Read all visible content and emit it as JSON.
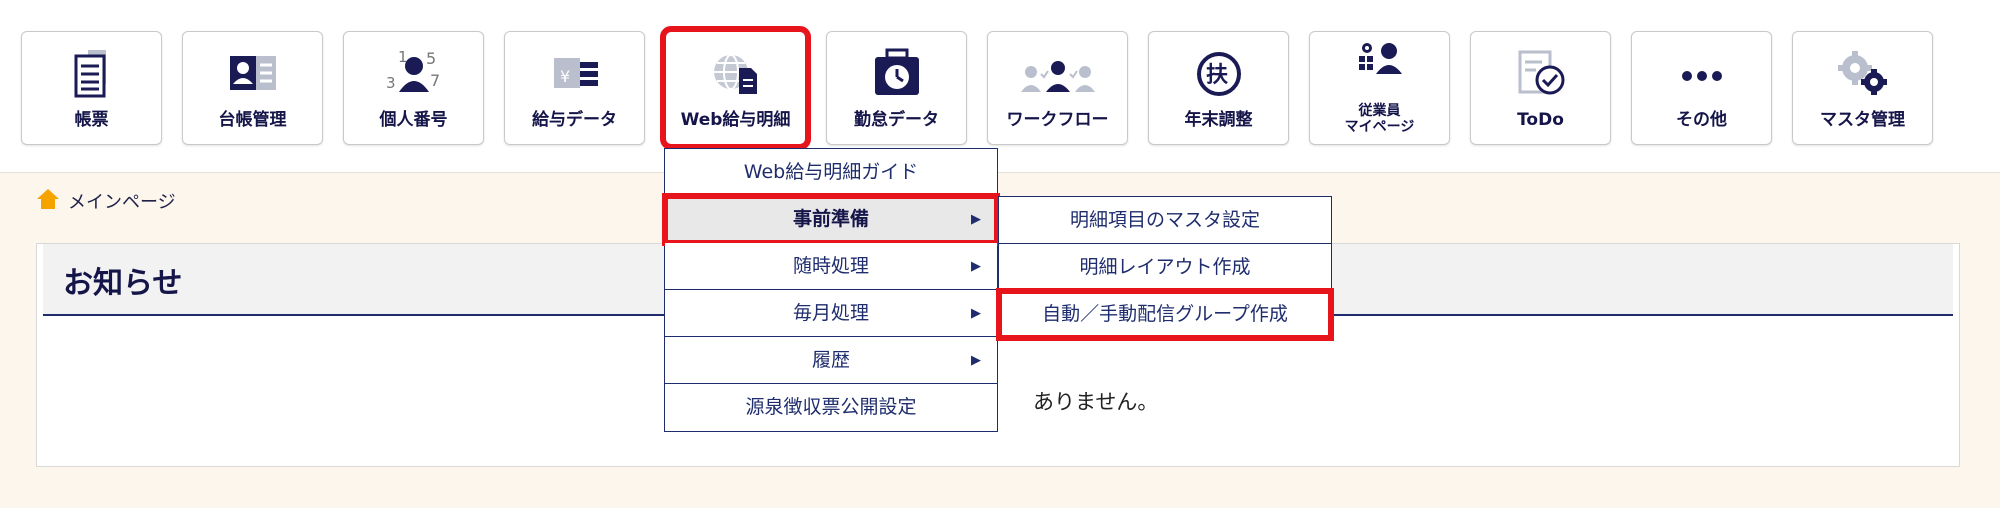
{
  "nav": {
    "items": [
      {
        "label": "帳票",
        "icon": "document-stack-icon"
      },
      {
        "label": "台帳管理",
        "icon": "id-card-icon"
      },
      {
        "label": "個人番号",
        "icon": "person-number-icon"
      },
      {
        "label": "給与データ",
        "icon": "payroll-data-icon"
      },
      {
        "label": "Web給与明細",
        "icon": "globe-document-icon"
      },
      {
        "label": "勤怠データ",
        "icon": "clock-box-icon"
      },
      {
        "label": "ワークフロー",
        "icon": "workflow-people-icon"
      },
      {
        "label": "年末調整",
        "icon": "fu-circle-icon"
      },
      {
        "label": "従業員",
        "label2": "マイページ",
        "icon": "employee-grid-icon"
      },
      {
        "label": "ToDo",
        "icon": "todo-check-icon"
      },
      {
        "label": "その他",
        "icon": "more-dots-icon"
      },
      {
        "label": "マスタ管理",
        "icon": "gears-icon"
      }
    ]
  },
  "breadcrumb": {
    "label": "メインページ",
    "icon": "home-icon"
  },
  "notice": {
    "title": "お知らせ",
    "message": "ありません。"
  },
  "menu": {
    "items": [
      {
        "label": "Web給与明細ガイド"
      },
      {
        "label": "事前準備",
        "arrow": "▶"
      },
      {
        "label": "随時処理",
        "arrow": "▶"
      },
      {
        "label": "毎月処理",
        "arrow": "▶"
      },
      {
        "label": "履歴",
        "arrow": "▶"
      },
      {
        "label": "源泉徴収票公開設定"
      }
    ]
  },
  "submenu": {
    "items": [
      {
        "label": "明細項目のマスタ設定"
      },
      {
        "label": "明細レイアウト作成"
      },
      {
        "label": "自動／手動配信グループ作成"
      }
    ]
  },
  "colors": {
    "highlight": "#e8141b",
    "navy": "#1f2d6e",
    "background": "#fdf6ec"
  }
}
